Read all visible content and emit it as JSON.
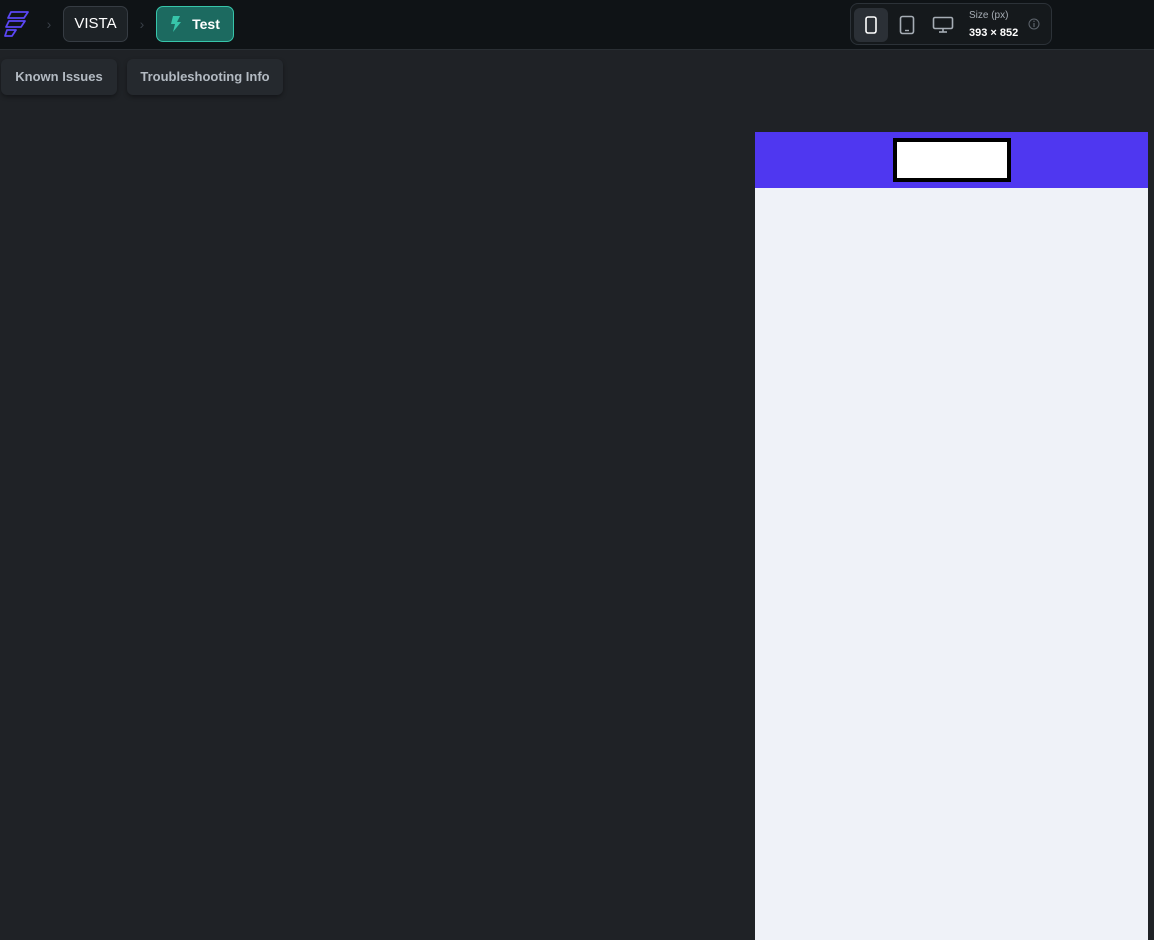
{
  "topbar": {
    "project_label": "VISTA",
    "test_label": "Test",
    "breadcrumb_separator": "›",
    "accent_color": "#37c5aa",
    "logo_color": "#5b47f5"
  },
  "device_selector": {
    "devices": [
      "phone-icon",
      "tablet-icon",
      "desktop-icon"
    ],
    "selected": "phone-icon",
    "size_label": "Size (px)",
    "size_value": "393 × 852"
  },
  "toolbar": {
    "known_issues_label": "Known Issues",
    "troubleshooting_label": "Troubleshooting Info"
  },
  "preview": {
    "app_bar_color": "#4f37f0",
    "background_color": "#eff2f8"
  }
}
